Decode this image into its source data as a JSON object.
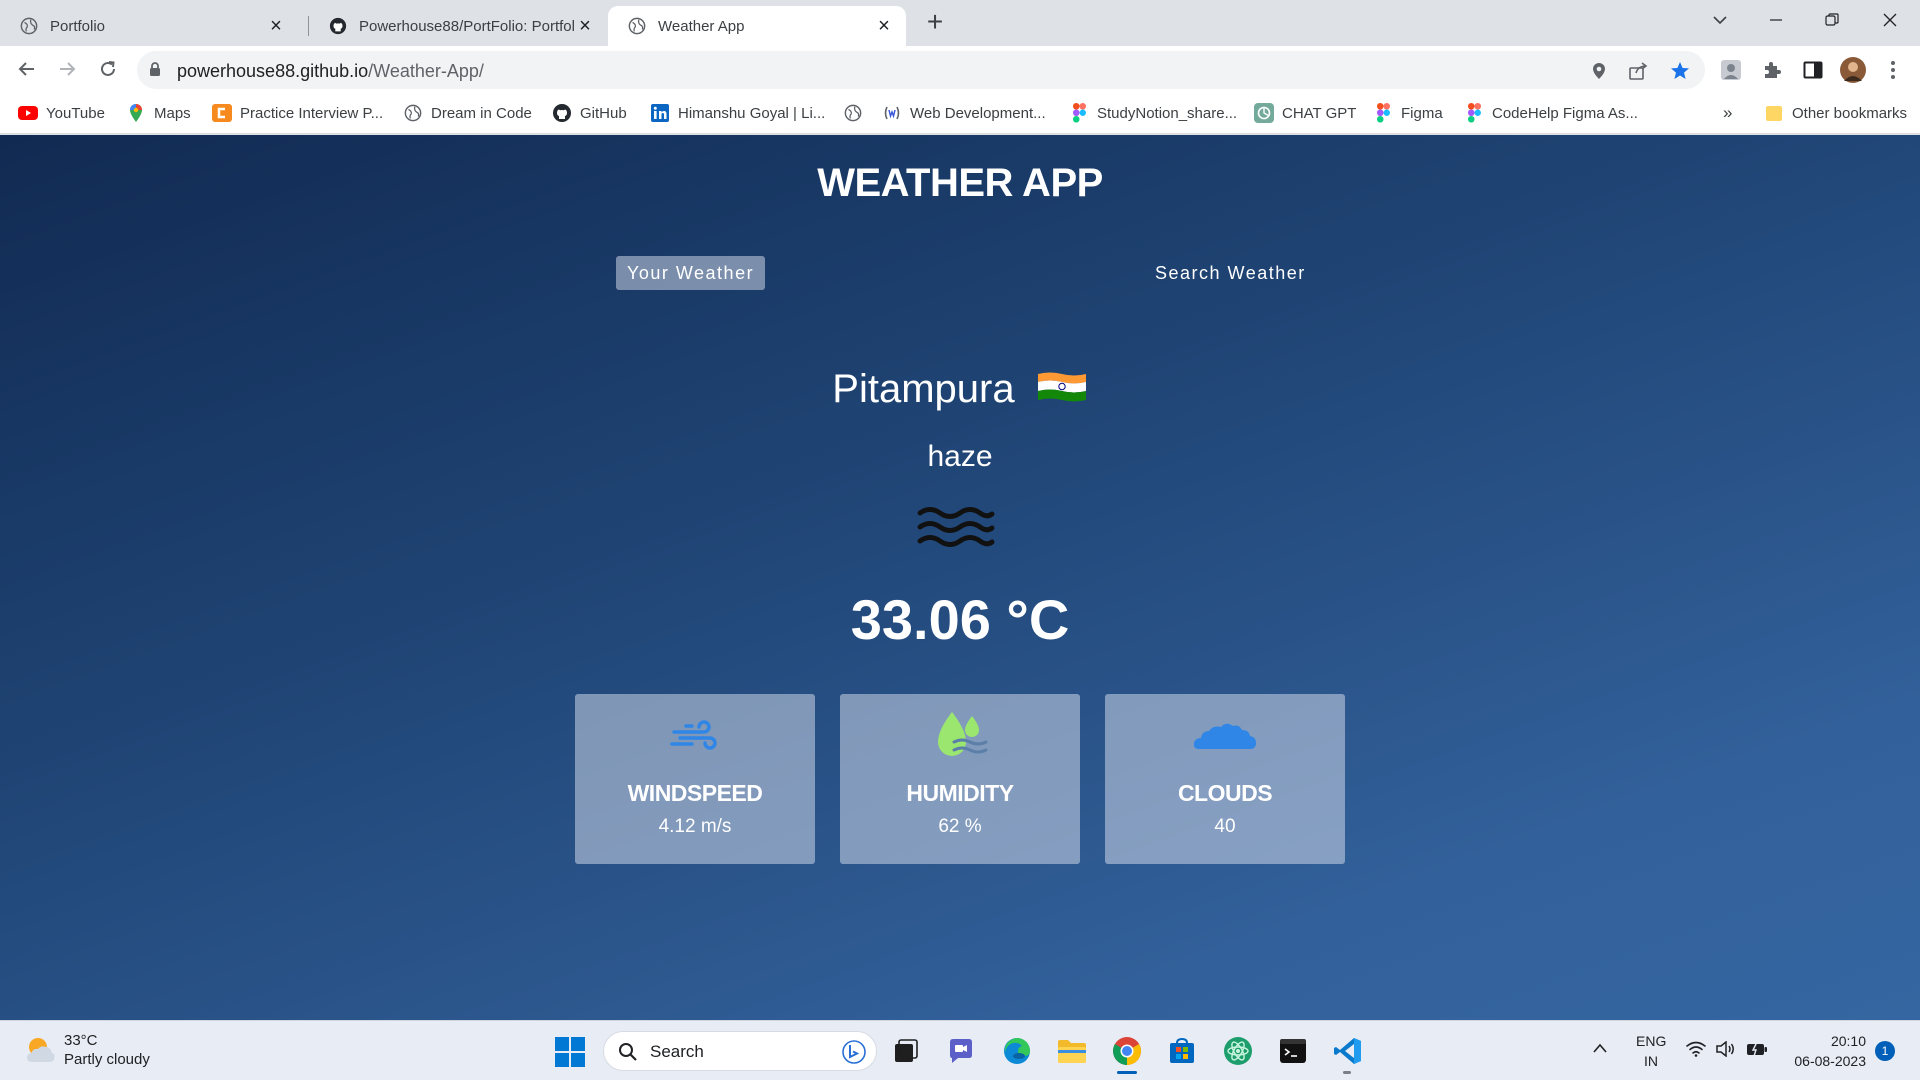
{
  "browser": {
    "tabs": [
      {
        "title": "Portfolio",
        "favicon": "globe-icon",
        "active": false
      },
      {
        "title": "Powerhouse88/PortFolio: Portfolio",
        "favicon": "github-icon",
        "active": false
      },
      {
        "title": "Weather App",
        "favicon": "globe-icon",
        "active": true
      }
    ],
    "url_host": "powerhouse88.github.io",
    "url_path": "/Weather-App/"
  },
  "bookmarks": [
    {
      "label": "YouTube",
      "icon": "youtube-icon"
    },
    {
      "label": "Maps",
      "icon": "maps-icon"
    },
    {
      "label": "Practice Interview P...",
      "icon": "codestudio-icon"
    },
    {
      "label": "Dream in Code",
      "icon": "globe-icon"
    },
    {
      "label": "GitHub",
      "icon": "github-icon"
    },
    {
      "label": "Himanshu Goyal | Li...",
      "icon": "linkedin-icon"
    },
    {
      "label": "",
      "icon": "globe-icon"
    },
    {
      "label": "Web Development...",
      "icon": "webdev-icon"
    },
    {
      "label": "StudyNotion_share...",
      "icon": "figma-icon"
    },
    {
      "label": "CHAT GPT",
      "icon": "chatgpt-icon"
    },
    {
      "label": "Figma",
      "icon": "figma-icon"
    },
    {
      "label": "CodeHelp Figma As...",
      "icon": "figma-icon"
    }
  ],
  "bookmarks_more": "»",
  "other_bookmarks": "Other bookmarks",
  "app": {
    "title": "WEATHER APP",
    "tabs": {
      "your_weather": "Your Weather",
      "search_weather": "Search Weather"
    },
    "city": "Pitampura",
    "country_flag": "india-flag",
    "description": "haze",
    "weather_icon": "haze-icon",
    "temperature": "33.06 °C",
    "cards": [
      {
        "label": "WINDSPEED",
        "value": "4.12 m/s",
        "icon": "wind-icon"
      },
      {
        "label": "HUMIDITY",
        "value": "62 %",
        "icon": "humidity-icon"
      },
      {
        "label": "CLOUDS",
        "value": "40",
        "icon": "cloud-icon"
      }
    ]
  },
  "taskbar": {
    "weather_temp": "33°C",
    "weather_desc": "Partly cloudy",
    "search_placeholder": "Search",
    "lang_1": "ENG",
    "lang_2": "IN",
    "time": "20:10",
    "date": "06-08-2023",
    "notification_count": "1"
  },
  "colors": {
    "app_bg_top": "#112a52",
    "app_bg_bottom": "#3566a1",
    "card_bg": "rgba(219,226,239,0.5)",
    "chrome_blue": "#1a73e8"
  }
}
